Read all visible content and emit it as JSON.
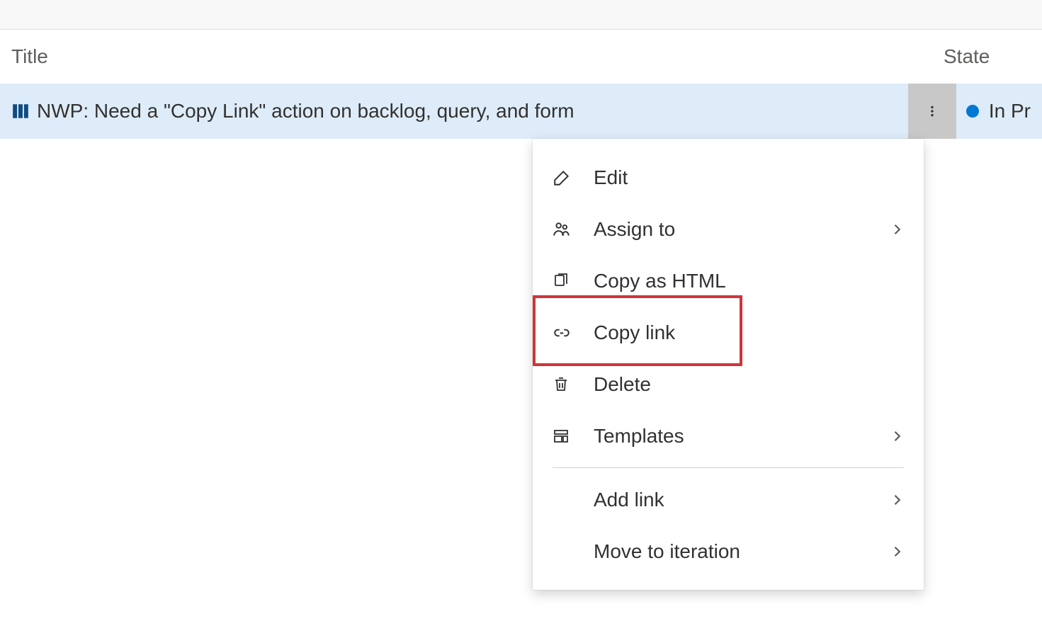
{
  "columns": {
    "title": "Title",
    "state": "State"
  },
  "workItem": {
    "title": "NWP: Need a \"Copy Link\" action on backlog, query, and form",
    "state": "In Pr",
    "stateColor": "#0078d4"
  },
  "menu": {
    "edit": "Edit",
    "assignTo": "Assign to",
    "copyAsHtml": "Copy as HTML",
    "copyLink": "Copy link",
    "delete": "Delete",
    "templates": "Templates",
    "addLink": "Add link",
    "moveToIteration": "Move to iteration"
  }
}
